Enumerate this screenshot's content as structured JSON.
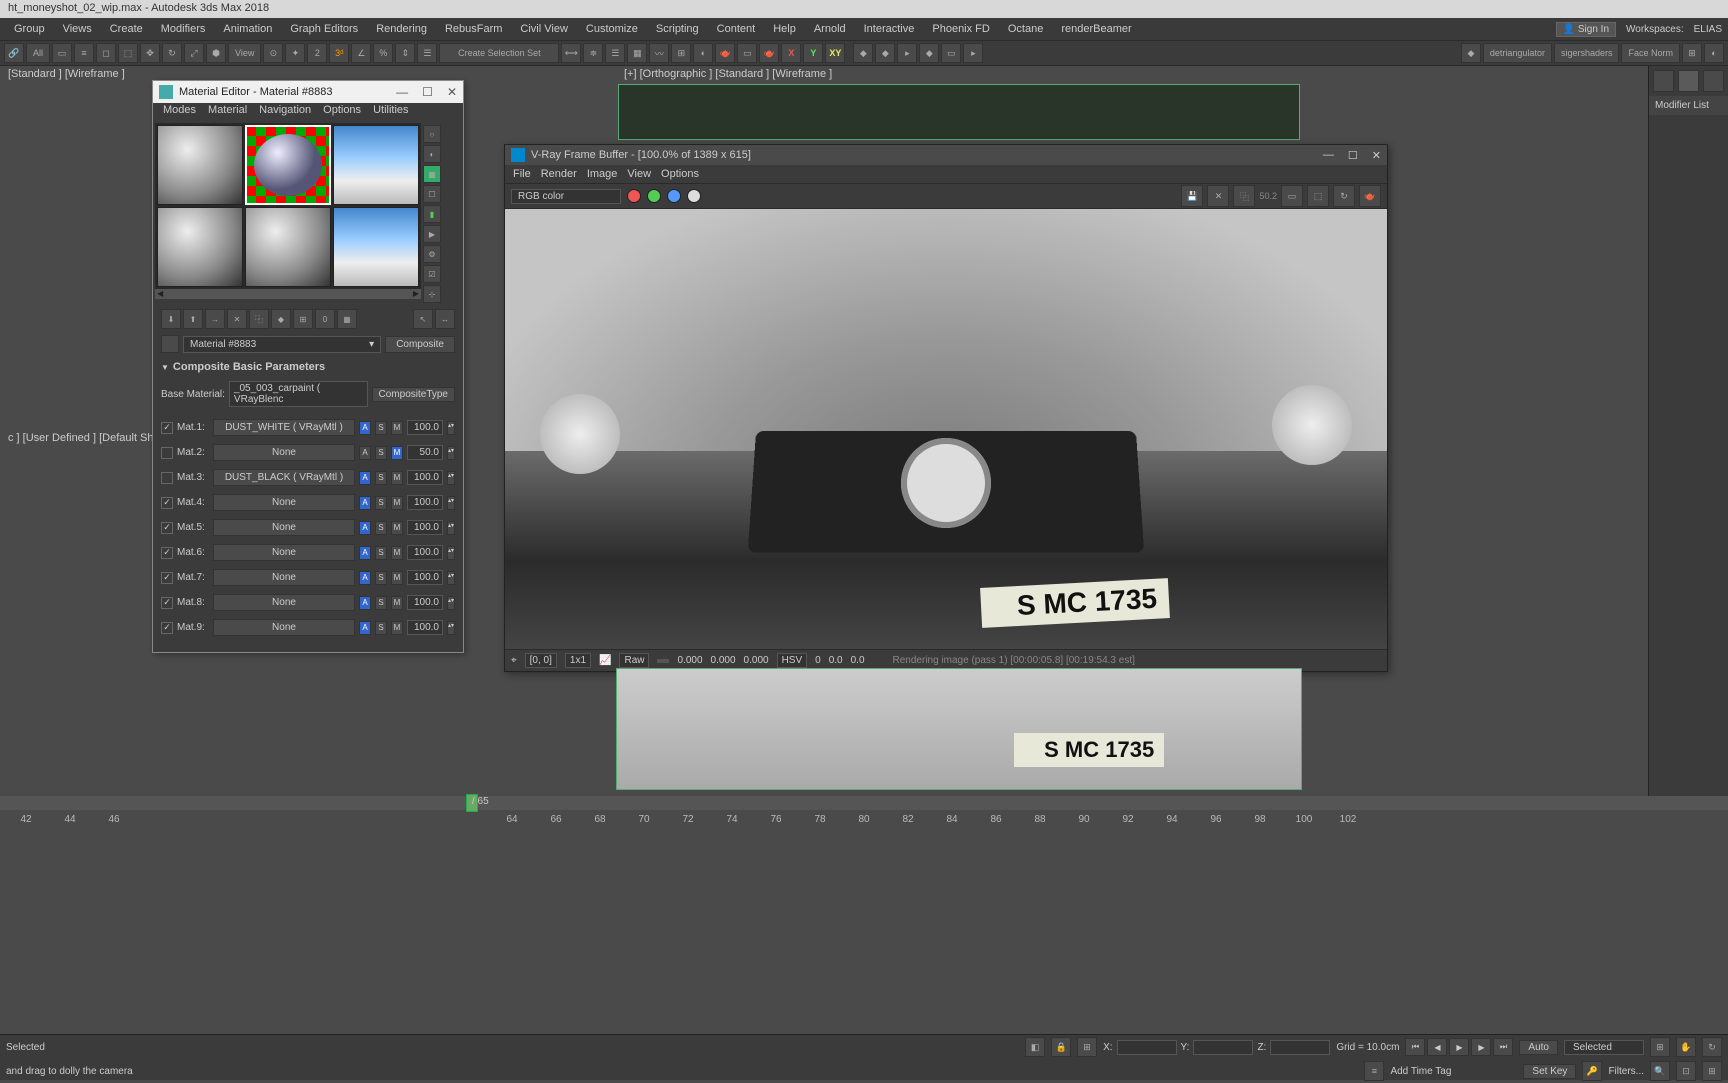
{
  "app": {
    "title": "ht_moneyshot_02_wip.max - Autodesk 3ds Max 2018"
  },
  "menubar": [
    "Group",
    "Views",
    "Create",
    "Modifiers",
    "Animation",
    "Graph Editors",
    "Rendering",
    "RebusFarm",
    "Civil View",
    "Customize",
    "Scripting",
    "Content",
    "Help",
    "Arnold",
    "Interactive",
    "Phoenix FD",
    "Octane",
    "renderBeamer"
  ],
  "signin": "Sign In",
  "workspaces_label": "Workspaces:",
  "workspaces_value": "ELIAS",
  "toolbar": {
    "all": "All",
    "view": "View",
    "createSelSet": "Create Selection Set",
    "sigershaders": "sigershaders",
    "facenorm": "Face Norm",
    "detriangulator": "detriangulator"
  },
  "viewports": {
    "vp1": "[Standard ] [Wireframe ]",
    "vp2": "[+] [Orthographic ] [Standard ] [Wireframe ]",
    "vp3": "c ] [User Defined ] [Default Shading ]"
  },
  "rightpanel": {
    "modifierList": "Modifier List"
  },
  "materialEditor": {
    "title": "Material Editor - Material #8883",
    "menu": [
      "Modes",
      "Material",
      "Navigation",
      "Options",
      "Utilities"
    ],
    "materialName": "Material #8883",
    "typeButton": "Composite",
    "rolloutTitle": "Composite Basic Parameters",
    "baseLabel": "Base Material:",
    "baseValue": "_05_003_carpaint  ( VRayBlenc",
    "compositeTypeBtn": "CompositeType",
    "rows": [
      {
        "chk": true,
        "label": "Mat.1:",
        "map": "DUST_WHITE  ( VRayMtl )",
        "a": true,
        "s": false,
        "m": false,
        "val": "100.0"
      },
      {
        "chk": false,
        "label": "Mat.2:",
        "map": "None",
        "a": false,
        "s": false,
        "m": true,
        "val": "50.0"
      },
      {
        "chk": false,
        "label": "Mat.3:",
        "map": "DUST_BLACK  ( VRayMtl )",
        "a": true,
        "s": false,
        "m": false,
        "val": "100.0"
      },
      {
        "chk": true,
        "label": "Mat.4:",
        "map": "None",
        "a": true,
        "s": false,
        "m": false,
        "val": "100.0"
      },
      {
        "chk": true,
        "label": "Mat.5:",
        "map": "None",
        "a": true,
        "s": false,
        "m": false,
        "val": "100.0"
      },
      {
        "chk": true,
        "label": "Mat.6:",
        "map": "None",
        "a": true,
        "s": false,
        "m": false,
        "val": "100.0"
      },
      {
        "chk": true,
        "label": "Mat.7:",
        "map": "None",
        "a": true,
        "s": false,
        "m": false,
        "val": "100.0"
      },
      {
        "chk": true,
        "label": "Mat.8:",
        "map": "None",
        "a": true,
        "s": false,
        "m": false,
        "val": "100.0"
      },
      {
        "chk": true,
        "label": "Mat.9:",
        "map": "None",
        "a": true,
        "s": false,
        "m": false,
        "val": "100.0"
      }
    ]
  },
  "vfb": {
    "title": "V-Ray Frame Buffer - [100.0% of 1389 x 615]",
    "menu": [
      "File",
      "Render",
      "Image",
      "View",
      "Options"
    ],
    "channel": "RGB color",
    "plate": "S MC 1735",
    "status": {
      "cursor_icon": "⌖",
      "pos": "[0, 0]",
      "zoom": "1x1",
      "mode": "Raw",
      "r": "0.000",
      "g": "0.000",
      "b": "0.000",
      "space": "HSV",
      "h": "0",
      "s": "0.0",
      "v": "0.0",
      "msg": "Rendering image (pass 1) [00:00:05.8] [00:19:54.3 est]"
    }
  },
  "timeline": {
    "currentLabel": "/ 65",
    "ticks": [
      "42",
      "44",
      "46",
      "64",
      "66",
      "68",
      "70",
      "72",
      "74",
      "76",
      "78",
      "80",
      "82",
      "84",
      "86",
      "88",
      "90",
      "92",
      "94",
      "96",
      "98",
      "100",
      "102"
    ]
  },
  "statusbar": {
    "selected": "Selected",
    "hint": "and drag to dolly the camera",
    "x": "X:",
    "y": "Y:",
    "z": "Z:",
    "grid": "Grid = 10.0cm",
    "addTimeTag": "Add Time Tag",
    "auto": "Auto",
    "setkey": "Set Key",
    "selected_dd": "Selected",
    "filters": "Filters..."
  }
}
